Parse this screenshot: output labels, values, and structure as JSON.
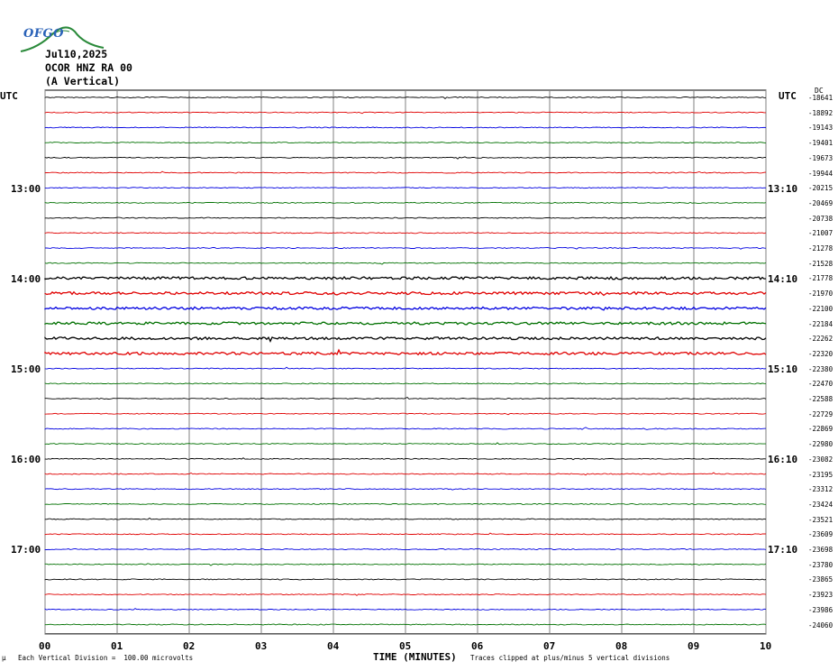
{
  "header": {
    "date": "Jul10,2025",
    "station": "OCOR HNZ RA 00",
    "component": "(A Vertical)"
  },
  "logo": {
    "text": "OFGO"
  },
  "left_axis": {
    "label": "UTC",
    "hours": [
      "13:00",
      "14:00",
      "15:00",
      "16:00",
      "17:00"
    ]
  },
  "right_axis": {
    "label": "UTC",
    "dc_label": "DC",
    "hours": [
      "13:10",
      "14:10",
      "15:10",
      "16:10",
      "17:10"
    ]
  },
  "footer": {
    "left_mark": "μ",
    "scale": "Each Vertical Division =  100.00 microvolts",
    "xlabel": "TIME (MINUTES)",
    "clip_note": "Traces clipped at plus/minus 5 vertical divisions"
  },
  "colors": {
    "trace_cycle": [
      "#000000",
      "#e00000",
      "#0000e0",
      "#007000"
    ],
    "grid": "#808080"
  },
  "chart_data": {
    "type": "line",
    "title": "",
    "xlabel": "TIME (MINUTES)",
    "ylabel": "",
    "xlim": [
      0,
      10
    ],
    "x_ticks": [
      "00",
      "01",
      "02",
      "03",
      "04",
      "05",
      "06",
      "07",
      "08",
      "09",
      "10"
    ],
    "traces_per_hour": 6,
    "series": [
      {
        "dc": "-18641"
      },
      {
        "dc": "-18892"
      },
      {
        "dc": "-19143"
      },
      {
        "dc": "-19401"
      },
      {
        "dc": "-19673"
      },
      {
        "dc": "-19944"
      },
      {
        "dc": "-20215"
      },
      {
        "dc": "-20469"
      },
      {
        "dc": "-20738"
      },
      {
        "dc": "-21007"
      },
      {
        "dc": "-21278"
      },
      {
        "dc": "-21528"
      },
      {
        "dc": "-21778"
      },
      {
        "dc": "-21970"
      },
      {
        "dc": "-22100"
      },
      {
        "dc": "-22184"
      },
      {
        "dc": "-22262"
      },
      {
        "dc": "-22320"
      },
      {
        "dc": "-22380"
      },
      {
        "dc": "-22470"
      },
      {
        "dc": "-22588"
      },
      {
        "dc": "-22729"
      },
      {
        "dc": "-22869"
      },
      {
        "dc": "-22980"
      },
      {
        "dc": "-23082"
      },
      {
        "dc": "-23195"
      },
      {
        "dc": "-23312"
      },
      {
        "dc": "-23424"
      },
      {
        "dc": "-23521"
      },
      {
        "dc": "-23609"
      },
      {
        "dc": "-23698"
      },
      {
        "dc": "-23780"
      },
      {
        "dc": "-23865"
      },
      {
        "dc": "-23923"
      },
      {
        "dc": "-23986"
      },
      {
        "dc": "-24060"
      }
    ]
  }
}
